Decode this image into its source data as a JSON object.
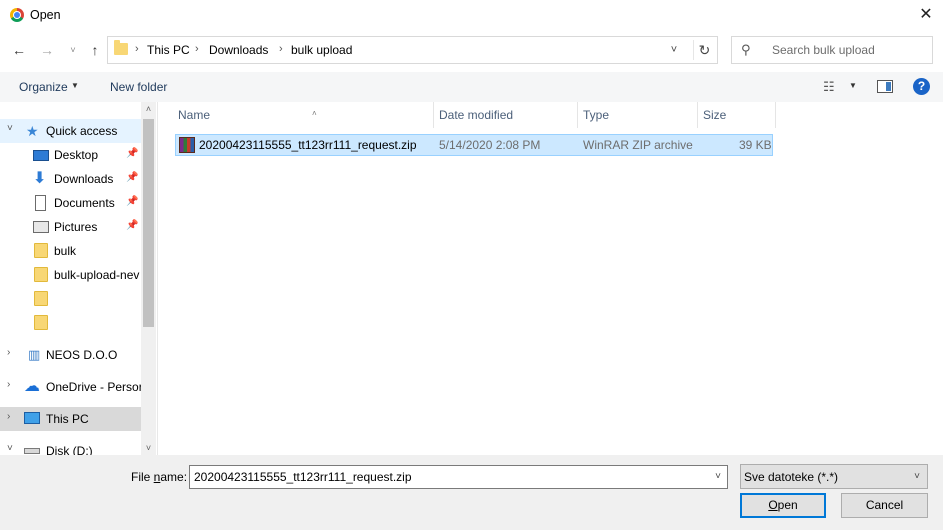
{
  "window": {
    "title": "Open",
    "close_glyph": "✕"
  },
  "navigation": {
    "back_glyph": "←",
    "forward_glyph": "→",
    "recent_glyph": "˅",
    "up_glyph": "↑"
  },
  "address": {
    "crumbs": [
      "This PC",
      "Downloads",
      "bulk upload"
    ],
    "separator": "›",
    "dropdown_glyph": "˅",
    "refresh_glyph": "↻"
  },
  "search": {
    "placeholder": "Search bulk upload"
  },
  "toolbar": {
    "organize_label": "Organize",
    "new_folder_label": "New folder",
    "help_label": "?"
  },
  "sidebar": {
    "items": [
      {
        "label": "Quick access",
        "icon": "star-icon",
        "expanded": true
      },
      {
        "label": "Desktop",
        "icon": "desktop-icon",
        "pinned": true
      },
      {
        "label": "Downloads",
        "icon": "downloads-icon",
        "pinned": true
      },
      {
        "label": "Documents",
        "icon": "documents-icon",
        "pinned": true
      },
      {
        "label": "Pictures",
        "icon": "pictures-icon",
        "pinned": true
      },
      {
        "label": "bulk",
        "icon": "folder-icon"
      },
      {
        "label": "bulk-upload-nev",
        "icon": "folder-icon"
      },
      {
        "label": "",
        "icon": "folder-icon"
      },
      {
        "label": "",
        "icon": "folder-icon"
      },
      {
        "label": "NEOS D.O.O",
        "icon": "building-icon"
      },
      {
        "label": "OneDrive - Persor",
        "icon": "onedrive-icon"
      },
      {
        "label": "This PC",
        "icon": "this-pc-icon",
        "selected": true
      },
      {
        "label": "Disk (D:)",
        "icon": "disk-icon",
        "expanded": true
      }
    ]
  },
  "columns": [
    "Name",
    "Date modified",
    "Type",
    "Size"
  ],
  "files": [
    {
      "name": "20200423115555_tt123rr111_request.zip",
      "date_modified": "5/14/2020 2:08 PM",
      "type": "WinRAR ZIP archive",
      "size": "39 KB",
      "icon": "winrar-archive-icon",
      "selected": true
    }
  ],
  "footer": {
    "file_name_label_prefix": "File ",
    "file_name_label_accel": "n",
    "file_name_label_suffix": "ame:",
    "file_name_value": "20200423115555_tt123rr111_request.zip",
    "file_type_value": "Sve datoteke (*.*)",
    "open_label_accel": "O",
    "open_label_rest": "pen",
    "cancel_label": "Cancel"
  },
  "colors": {
    "selection": "#cce8ff",
    "selection_border": "#99d1ff",
    "accent": "#0078d7",
    "footer_bg": "#f0f0f0"
  }
}
